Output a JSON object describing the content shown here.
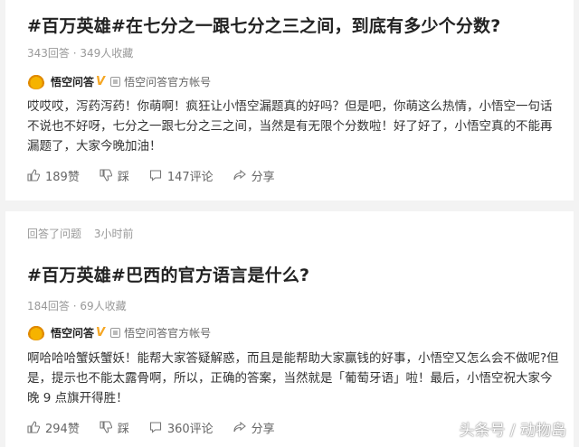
{
  "posts": [
    {
      "title": "#百万英雄#在七分之一跟七分之三之间，到底有多少个分数?",
      "answers": "343回答",
      "favorites": "349人收藏",
      "author": {
        "name": "悟空问答",
        "badge": "V",
        "title": "悟空问答官方帐号"
      },
      "body": "哎哎哎，泻药泻药！你萌啊！疯狂让小悟空漏题真的好吗？但是吧，你萌这么热情，小悟空一句话不说也不好呀，七分之一跟七分之三之间，当然是有无限个分数啦！好了好了，小悟空真的不能再漏题了，大家今晚加油！",
      "likes": "189赞",
      "dislike": "踩",
      "comments": "147评论",
      "share": "分享"
    },
    {
      "meta_action": "回答了问题",
      "meta_time": "3小时前",
      "title": "#百万英雄#巴西的官方语言是什么?",
      "answers": "184回答",
      "favorites": "69人收藏",
      "author": {
        "name": "悟空问答",
        "badge": "V",
        "title": "悟空问答官方帐号"
      },
      "body": "啊哈哈哈蟹妖蟹妖！能帮大家答疑解惑，而且是能帮助大家赢钱的好事，小悟空又怎么会不做呢?但是，提示也不能太露骨啊，所以，正确的答案，当然就是「葡萄牙语」啦！最后，小悟空祝大家今晚 9 点旗开得胜！",
      "likes": "294赞",
      "dislike": "踩",
      "comments": "360评论",
      "share": "分享"
    }
  ],
  "watermark": "头条号 / 动物岛",
  "colors": {
    "title": "#222222",
    "meta": "#999999",
    "badge": "#f5a623"
  }
}
